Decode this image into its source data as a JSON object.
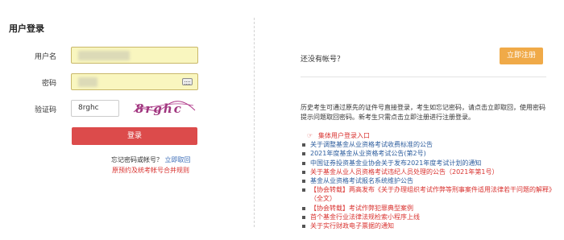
{
  "login": {
    "title": "用户登录",
    "username_label": "用户名",
    "password_label": "密码",
    "captcha_label": "验证码",
    "captcha_value": "8rghc",
    "captcha_image_text": "8rghc",
    "login_button": "登录",
    "forgot_prefix": "忘记密码或帐号？",
    "forgot_link": "立即取回",
    "merge_link": "原预约及统考帐号合并规则"
  },
  "register": {
    "prompt": "还没有帐号？",
    "button": "立即注册"
  },
  "notice": "历史考生可通过原先的证件号直接登录，考生如忘记密码，请点击立即取回，使用密码提示问题取回密码。新考生只需点击立即注册进行注册登录。",
  "news": [
    {
      "text": "集体用户登录入口",
      "color": "#d9322f",
      "icon": "pointing-hand-icon"
    },
    {
      "text": "关于调整基金从业资格考试收费标准的公告",
      "color": "#2e5e9e"
    },
    {
      "text": "2021年度基金从业资格考试公告(第2号)",
      "color": "#2e5e9e"
    },
    {
      "text": "中国证券投资基金业协会关于发布2021年度考试计划的通知",
      "color": "#2e5e9e"
    },
    {
      "text": "关于基金从业人员资格考试违纪人员处理的公告（2021年第1号）",
      "color": "#d9322f"
    },
    {
      "text": "基金从业资格考试报名系统维护公告",
      "color": "#2e5e9e"
    },
    {
      "text": "【协会转载】两高发布《关于办理组织考试作弊等刑事案件适用法律若干问题的解释》（全文）",
      "color": "#d9322f"
    },
    {
      "text": "【协会转载】考试作弊犯罪典型案例",
      "color": "#d9322f"
    },
    {
      "text": "首个基金行业法律法规检索小程序上线",
      "color": "#d9322f"
    },
    {
      "text": "关于实行财政电子票据的通知",
      "color": "#d9322f"
    }
  ],
  "colors": {
    "login_button": "#dc4b4b",
    "register_button": "#f0aa48",
    "input_autofill": "#f9f6bf",
    "link_blue": "#2e5e9e",
    "link_red": "#d9322f"
  }
}
